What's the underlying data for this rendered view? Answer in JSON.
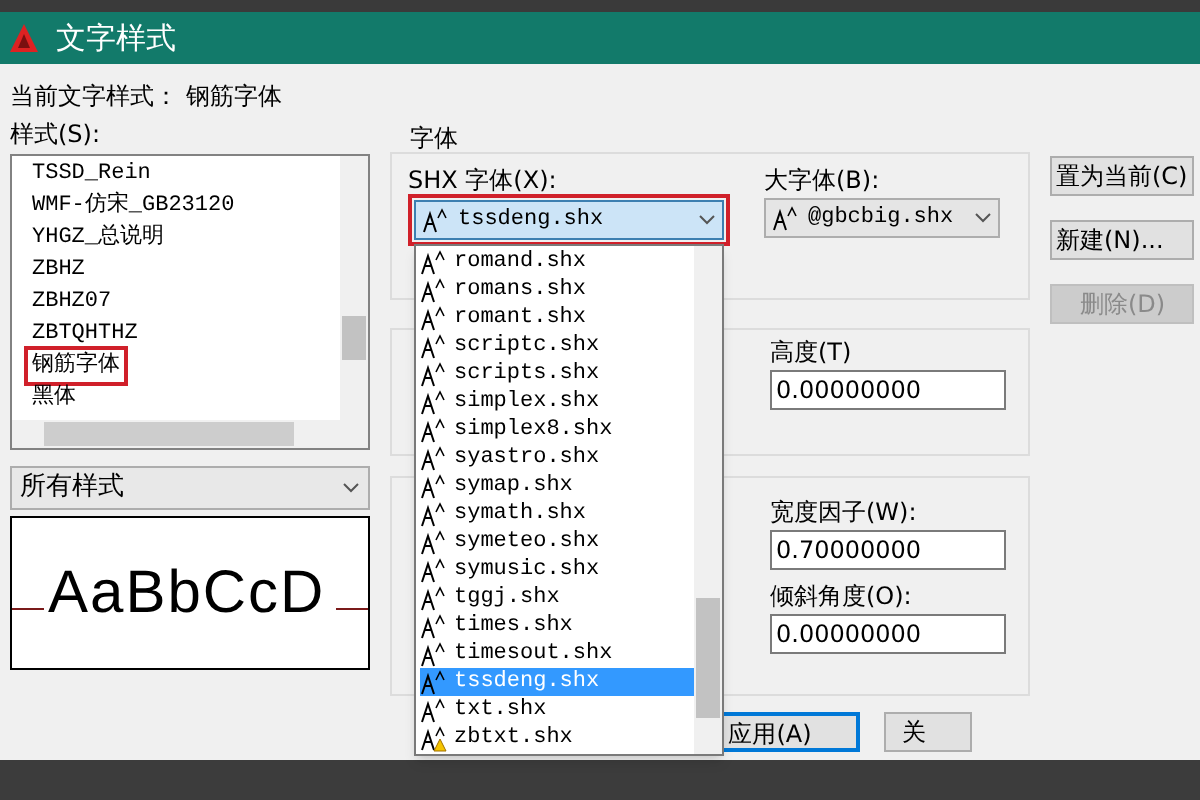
{
  "window": {
    "title": "文字样式"
  },
  "current_style": {
    "label": "当前文字样式：",
    "value": "钢筋字体"
  },
  "styles": {
    "label": "样式(S):",
    "items": [
      {
        "name": "TSSD_Rein",
        "selected": false
      },
      {
        "name": "WMF-仿宋_GB23120",
        "selected": false
      },
      {
        "name": "YHGZ_总说明",
        "selected": false
      },
      {
        "name": "ZBHZ",
        "selected": false
      },
      {
        "name": "ZBHZ07",
        "selected": false
      },
      {
        "name": "ZBTQHTHZ",
        "selected": false
      },
      {
        "name": "钢筋字体",
        "selected": true
      },
      {
        "name": "黑体",
        "selected": false
      }
    ]
  },
  "filter": {
    "value": "所有样式"
  },
  "preview": {
    "text": "AaBbCcD"
  },
  "font_group": {
    "title": "字体",
    "shx_label": "SHX 字体(X):",
    "shx_value": "tssdeng.shx",
    "big_label": "大字体(B):",
    "big_value": "@gbcbig.shx"
  },
  "size_group": {
    "height_label": "高度(T)",
    "height_value": "0.00000000"
  },
  "effects_group": {
    "width_label": "宽度因子(W):",
    "width_value": "0.70000000",
    "oblique_label": "倾斜角度(O):",
    "oblique_value": "0.00000000"
  },
  "side_buttons": [
    {
      "label": "置为当前(C)",
      "disabled": false
    },
    {
      "label": "新建(N)...",
      "disabled": false
    },
    {
      "label": "删除(D)",
      "disabled": true
    }
  ],
  "bottom_buttons": [
    {
      "label": "应用(A)",
      "focused": true
    },
    {
      "label": "关",
      "focused": false
    }
  ],
  "font_dropdown": [
    {
      "name": "romand.shx",
      "kind": "font",
      "selected": false
    },
    {
      "name": "romans.shx",
      "kind": "font",
      "selected": false
    },
    {
      "name": "romant.shx",
      "kind": "font",
      "selected": false
    },
    {
      "name": "scriptc.shx",
      "kind": "font",
      "selected": false
    },
    {
      "name": "scripts.shx",
      "kind": "font",
      "selected": false
    },
    {
      "name": "simplex.shx",
      "kind": "font",
      "selected": false
    },
    {
      "name": "simplex8.shx",
      "kind": "font",
      "selected": false
    },
    {
      "name": "syastro.shx",
      "kind": "font",
      "selected": false
    },
    {
      "name": "symap.shx",
      "kind": "font",
      "selected": false
    },
    {
      "name": "symath.shx",
      "kind": "font",
      "selected": false
    },
    {
      "name": "symeteo.shx",
      "kind": "font",
      "selected": false
    },
    {
      "name": "symusic.shx",
      "kind": "font",
      "selected": false
    },
    {
      "name": "tggj.shx",
      "kind": "font",
      "selected": false
    },
    {
      "name": "times.shx",
      "kind": "font",
      "selected": false
    },
    {
      "name": "timesout.shx",
      "kind": "font",
      "selected": false
    },
    {
      "name": "tssdeng.shx",
      "kind": "font",
      "selected": true
    },
    {
      "name": "txt.shx",
      "kind": "font",
      "selected": false
    },
    {
      "name": "zbtxt.shx",
      "kind": "warning",
      "selected": false
    }
  ]
}
